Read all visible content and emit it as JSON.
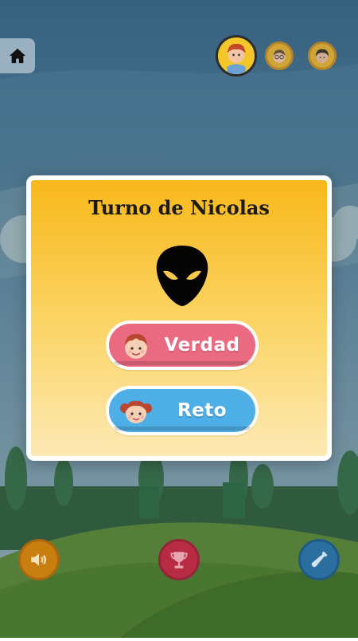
{
  "header": {
    "home_icon": "home-icon",
    "players": [
      {
        "name": "player-red-hair-boy",
        "active": true
      },
      {
        "name": "player-glasses-kid",
        "active": false
      },
      {
        "name": "player-dark-hair-boy",
        "active": false
      }
    ]
  },
  "dialog": {
    "title": "Turno de Nicolas",
    "player_icon": "alien-icon",
    "truth_button": {
      "label": "Verdad",
      "icon": "boy-face-icon",
      "color": "#ea6a82"
    },
    "dare_button": {
      "label": "Reto",
      "icon": "girl-face-icon",
      "color": "#4eaee6"
    }
  },
  "footer": {
    "sound_button": {
      "icon": "speaker-icon",
      "color": "#c97e10"
    },
    "trophy_button": {
      "icon": "trophy-icon",
      "color": "#b82c43"
    },
    "bottle_button": {
      "icon": "bottle-icon",
      "color": "#2a6fa0"
    }
  },
  "colors": {
    "sky": "#35617f",
    "hills": "#4e8a3a",
    "dialog_gradient_top": "#f8b81a",
    "dialog_gradient_bottom": "#fde9b4"
  }
}
